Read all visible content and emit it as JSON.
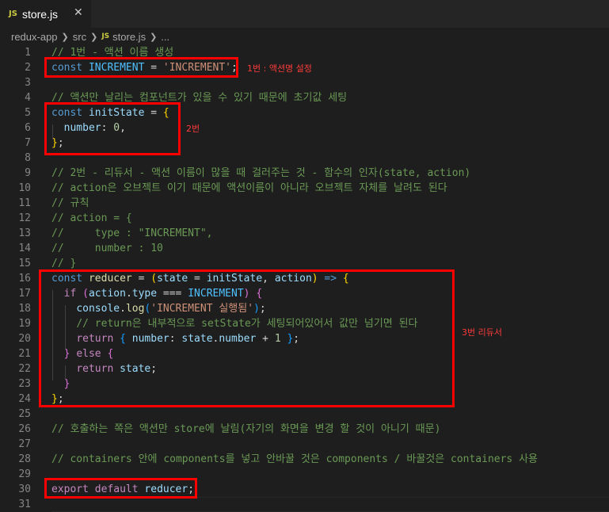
{
  "tab": {
    "badge": "JS",
    "label": "store.js",
    "close": "✕"
  },
  "breadcrumb": {
    "parts": [
      "redux-app",
      "src"
    ],
    "badge": "JS",
    "file": "store.js",
    "ellipsis": "..."
  },
  "annotations": {
    "a1": "1번 : 액션명 설정",
    "a2": "2번",
    "a3": "3번 리듀서"
  },
  "lines": [
    {
      "n": "1",
      "t": [
        [
          "c-comment",
          "// 1번 - 액션 이름 생성"
        ]
      ]
    },
    {
      "n": "2",
      "t": [
        [
          "c-kw",
          "const "
        ],
        [
          "c-const",
          "INCREMENT"
        ],
        [
          "c-punc",
          " = "
        ],
        [
          "c-str",
          "'INCREMENT'"
        ],
        [
          "c-punc",
          ";"
        ]
      ]
    },
    {
      "n": "3",
      "t": []
    },
    {
      "n": "4",
      "t": [
        [
          "c-comment",
          "// 액션만 날리는 컴포넌트가 있을 수 있기 때문에 초기값 세팅"
        ]
      ]
    },
    {
      "n": "5",
      "t": [
        [
          "c-kw",
          "const "
        ],
        [
          "c-var",
          "initState"
        ],
        [
          "c-punc",
          " = "
        ],
        [
          "c-brace",
          "{"
        ]
      ]
    },
    {
      "n": "6",
      "t": [
        [
          "c-punc",
          "  "
        ],
        [
          "c-var",
          "number"
        ],
        [
          "c-punc",
          ": "
        ],
        [
          "c-num",
          "0"
        ],
        [
          "c-punc",
          ","
        ]
      ]
    },
    {
      "n": "7",
      "t": [
        [
          "c-brace",
          "}"
        ],
        [
          "c-punc",
          ";"
        ]
      ]
    },
    {
      "n": "8",
      "t": []
    },
    {
      "n": "9",
      "t": [
        [
          "c-comment",
          "// 2번 - 리듀서 - 액션 이름이 많을 때 걸러주는 것 - 함수의 인자(state, action)"
        ]
      ]
    },
    {
      "n": "10",
      "t": [
        [
          "c-comment",
          "// action은 오브젝트 이기 때문에 액션이름이 아니라 오브젝트 자체를 날려도 된다"
        ]
      ]
    },
    {
      "n": "11",
      "t": [
        [
          "c-comment",
          "// 규칙"
        ]
      ]
    },
    {
      "n": "12",
      "t": [
        [
          "c-comment",
          "// action = {"
        ]
      ]
    },
    {
      "n": "13",
      "t": [
        [
          "c-comment",
          "//     type : \"INCREMENT\","
        ]
      ]
    },
    {
      "n": "14",
      "t": [
        [
          "c-comment",
          "//     number : 10"
        ]
      ]
    },
    {
      "n": "15",
      "t": [
        [
          "c-comment",
          "// }"
        ]
      ]
    },
    {
      "n": "16",
      "t": [
        [
          "c-kw",
          "const "
        ],
        [
          "c-fn",
          "reducer"
        ],
        [
          "c-punc",
          " = "
        ],
        [
          "c-brace",
          "("
        ],
        [
          "c-var",
          "state"
        ],
        [
          "c-punc",
          " = "
        ],
        [
          "c-var",
          "initState"
        ],
        [
          "c-punc",
          ", "
        ],
        [
          "c-var",
          "action"
        ],
        [
          "c-brace",
          ")"
        ],
        [
          "c-kw",
          " => "
        ],
        [
          "c-brace",
          "{"
        ]
      ]
    },
    {
      "n": "17",
      "t": [
        [
          "c-punc",
          "  "
        ],
        [
          "c-ctrl",
          "if"
        ],
        [
          "c-punc",
          " "
        ],
        [
          "c-brace2",
          "("
        ],
        [
          "c-var",
          "action"
        ],
        [
          "c-punc",
          "."
        ],
        [
          "c-var",
          "type"
        ],
        [
          "c-punc",
          " === "
        ],
        [
          "c-const",
          "INCREMENT"
        ],
        [
          "c-brace2",
          ")"
        ],
        [
          "c-punc",
          " "
        ],
        [
          "c-brace2",
          "{"
        ]
      ]
    },
    {
      "n": "18",
      "t": [
        [
          "c-punc",
          "    "
        ],
        [
          "c-var",
          "console"
        ],
        [
          "c-punc",
          "."
        ],
        [
          "c-fn",
          "log"
        ],
        [
          "c-brace3",
          "("
        ],
        [
          "c-str",
          "'INCREMENT 실행됨'"
        ],
        [
          "c-brace3",
          ")"
        ],
        [
          "c-punc",
          ";"
        ]
      ]
    },
    {
      "n": "19",
      "t": [
        [
          "c-punc",
          "    "
        ],
        [
          "c-comment",
          "// return은 내부적으로 setState가 세팅되어있어서 값만 넘기면 된다"
        ]
      ]
    },
    {
      "n": "20",
      "t": [
        [
          "c-punc",
          "    "
        ],
        [
          "c-ctrl",
          "return"
        ],
        [
          "c-punc",
          " "
        ],
        [
          "c-brace3",
          "{"
        ],
        [
          "c-punc",
          " "
        ],
        [
          "c-var",
          "number"
        ],
        [
          "c-punc",
          ": "
        ],
        [
          "c-var",
          "state"
        ],
        [
          "c-punc",
          "."
        ],
        [
          "c-var",
          "number"
        ],
        [
          "c-punc",
          " + "
        ],
        [
          "c-num",
          "1"
        ],
        [
          "c-punc",
          " "
        ],
        [
          "c-brace3",
          "}"
        ],
        [
          "c-punc",
          ";"
        ]
      ]
    },
    {
      "n": "21",
      "t": [
        [
          "c-punc",
          "  "
        ],
        [
          "c-brace2",
          "}"
        ],
        [
          "c-punc",
          " "
        ],
        [
          "c-ctrl",
          "else"
        ],
        [
          "c-punc",
          " "
        ],
        [
          "c-brace2",
          "{"
        ]
      ]
    },
    {
      "n": "22",
      "t": [
        [
          "c-punc",
          "    "
        ],
        [
          "c-ctrl",
          "return"
        ],
        [
          "c-punc",
          " "
        ],
        [
          "c-var",
          "state"
        ],
        [
          "c-punc",
          ";"
        ]
      ]
    },
    {
      "n": "23",
      "t": [
        [
          "c-punc",
          "  "
        ],
        [
          "c-brace2",
          "}"
        ]
      ]
    },
    {
      "n": "24",
      "t": [
        [
          "c-brace",
          "}"
        ],
        [
          "c-punc",
          ";"
        ]
      ]
    },
    {
      "n": "25",
      "t": []
    },
    {
      "n": "26",
      "t": [
        [
          "c-comment",
          "// 호출하는 쪽은 액션만 store에 날림(자기의 화면을 변경 할 것이 아니기 때문)"
        ]
      ]
    },
    {
      "n": "27",
      "t": []
    },
    {
      "n": "28",
      "t": [
        [
          "c-comment",
          "// containers 안에 components를 넣고 안바꿀 것은 components / 바꿀것은 containers 사용"
        ]
      ]
    },
    {
      "n": "29",
      "t": []
    },
    {
      "n": "30",
      "t": [
        [
          "c-ctrl",
          "export"
        ],
        [
          "c-punc",
          " "
        ],
        [
          "c-ctrl",
          "default"
        ],
        [
          "c-punc",
          " "
        ],
        [
          "c-var",
          "reducer"
        ],
        [
          "c-punc",
          ";"
        ]
      ]
    },
    {
      "n": "31",
      "t": []
    }
  ]
}
